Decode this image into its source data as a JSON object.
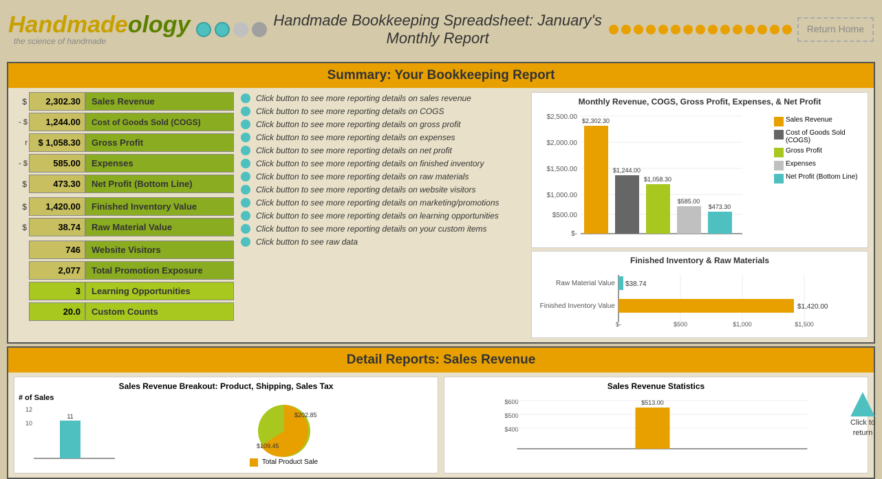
{
  "header": {
    "logo1": "Handmade",
    "logo2": "ology",
    "logo_sub": "the science of handmade",
    "title": "Handmade Bookkeeping Spreadsheet:  January's Monthly Report",
    "return_label": "Return\nHome"
  },
  "summary": {
    "section_title": "Summary:  Your Bookkeeping Report",
    "rows": [
      {
        "prefix": "$",
        "value": "2,302.30",
        "label": "Sales Revenue"
      },
      {
        "prefix": "-  $",
        "value": "1,244.00",
        "label": "Cost of Goods Sold (COGS)"
      },
      {
        "prefix": "",
        "value": "$ 1,058.30",
        "label": "Gross Profit"
      },
      {
        "prefix": "-  $",
        "value": "585.00",
        "label": "Expenses"
      },
      {
        "prefix": "$",
        "value": "473.30",
        "label": "Net Profit (Bottom Line)"
      }
    ],
    "inventory_rows": [
      {
        "prefix": "$",
        "value": "1,420.00",
        "label": "Finished Inventory Value"
      },
      {
        "prefix": "$",
        "value": "38.74",
        "label": "Raw Material Value"
      }
    ],
    "stat_rows": [
      {
        "value": "746",
        "label": "Website Visitors"
      },
      {
        "value": "2,077",
        "label": "Total Promotion Exposure"
      },
      {
        "value": "3",
        "label": "Learning Opportunities"
      },
      {
        "value": "20.0",
        "label": "Custom Counts"
      }
    ],
    "click_items": [
      "Click button to see more reporting details on sales revenue",
      "Click button to see more reporting details on COGS",
      "Click button to see more reporting details on gross profit",
      "Click button to see more reporting details on expenses",
      "Click button to see more reporting details on net profit",
      "Click button to see more reporting details on finished inventory",
      "Click button to see more reporting details on raw materials",
      "Click button to see more reporting details on website visitors",
      "Click button to see more reporting details on marketing/promotions",
      "Click button to see more reporting details on learning opportunities",
      "Click button to see more reporting details on your custom items",
      "Click button to see raw data"
    ],
    "chart1_title": "Monthly Revenue, COGS, Gross Profit, Expenses, & Net Profit",
    "chart1_bars": [
      {
        "label": "Sales Revenue",
        "value": 2302.3,
        "display": "$2,302.30",
        "color": "#e8a000"
      },
      {
        "label": "Cost of Goods Sold (COGS)",
        "value": 1244.0,
        "display": "$1,244.00",
        "color": "#666666"
      },
      {
        "label": "Gross Profit",
        "value": 1058.3,
        "display": "$1,058.30",
        "color": "#a8c820"
      },
      {
        "label": "Expenses",
        "value": 585.0,
        "display": "$585.00",
        "color": "#c0c0c0"
      },
      {
        "label": "Net Profit (Bottom Line)",
        "value": 473.3,
        "display": "$473.30",
        "color": "#4ec0c0"
      }
    ],
    "chart2_title": "Finished Inventory & Raw Materials",
    "chart2_bars": [
      {
        "label": "Raw Material Value",
        "value": 38.74,
        "display": "$38.74",
        "color": "#4ec0c0"
      },
      {
        "label": "Finished Inventory Value",
        "value": 1420.0,
        "display": "$1,420.00",
        "color": "#e8a000"
      }
    ]
  },
  "detail": {
    "section_title": "Detail Reports:  Sales Revenue",
    "chart1_title": "Sales Revenue Breakout:  Product, Shipping, Sales Tax",
    "chart2_title": "Sales Revenue Statistics",
    "sales_count_label": "# of Sales",
    "sales_values": [
      11
    ],
    "bar_value1": "$202.85",
    "bar_value2": "$109.45",
    "stat_bar_value": "$513.00",
    "y_labels": [
      "12",
      "10"
    ],
    "legend_items": [
      "Total Product Sale"
    ]
  },
  "return_click": {
    "arrow_label": "↑",
    "text": "Click to\nreturn"
  }
}
